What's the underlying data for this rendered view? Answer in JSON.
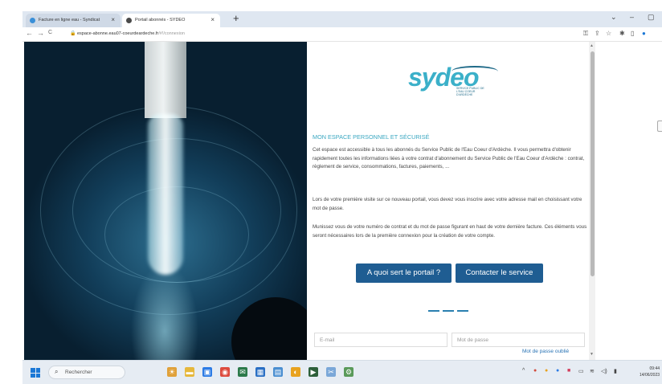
{
  "browser": {
    "tabs": [
      {
        "label": "Facture en ligne eau - Syndicat",
        "fav_color": "#3a8fd8"
      },
      {
        "label": "Portail abonnés - SYDEO",
        "fav_color": "#4a4a4a"
      }
    ],
    "new_tab_glyph": "+",
    "window_controls": [
      "⌄",
      "–",
      "▢"
    ],
    "url_host": "espace-abonne.eau07-coeurdeardeche.fr",
    "url_path": "/#!/connexion",
    "nav": {
      "back": "←",
      "forward": "→",
      "reload": "C"
    },
    "extension_icons": [
      "key-icon",
      "share-icon",
      "star-icon",
      "extension-icon",
      "sidebar-icon",
      "profile-icon"
    ]
  },
  "logo": {
    "text": "sydeo",
    "tagline": "SERVICE PUBLIC DE L'EAU COEUR D'ARDÈCHE"
  },
  "page": {
    "heading": "MON ESPACE PERSONNEL ET SÉCURISÉ",
    "paragraph1": "Cet espace est accessible à tous les abonnés du Service Public de l'Eau Coeur d'Ardèche. Il vous permettra d'obtenir rapidement toutes les informations liées à votre contrat d'abonnement du Service Public de l'Eau Coeur d'Ardèche : contrat, règlement de service, consommations, factures, paiements, ...",
    "paragraph2": "Lors de votre première visite sur ce nouveau portail, vous devez vous inscrire avec votre adresse mail en choisissant votre mot de passe.",
    "paragraph3": "Munissez vous de votre numéro de contrat et du mot de passe figurant en haut de votre dernière facture. Ces éléments vous seront nécessaires lors de la première connexion pour la création de votre compte.",
    "button_about": "A quoi sert le portail ?",
    "button_contact": "Contacter le service",
    "email_placeholder": "E-mail",
    "password_placeholder": "Mot de passe",
    "forgot_password": "Mot de passe oublié"
  },
  "taskbar": {
    "search_label": "Rechercher",
    "app_icons": [
      {
        "name": "weather-app-icon",
        "color": "#e0a13a"
      },
      {
        "name": "file-explorer-icon",
        "color": "#e6b83c"
      },
      {
        "name": "store-icon",
        "color": "#2c7be5"
      },
      {
        "name": "chrome-icon",
        "color": "#dd4b3e"
      },
      {
        "name": "mail-icon",
        "color": "#2c7a4b"
      },
      {
        "name": "calendar-icon",
        "color": "#2a6fc4"
      },
      {
        "name": "notes-icon",
        "color": "#4b8fd1"
      },
      {
        "name": "paint-icon",
        "color": "#e8a21f"
      },
      {
        "name": "media-icon",
        "color": "#2d5f3a"
      },
      {
        "name": "snipping-icon",
        "color": "#7aa7d8"
      },
      {
        "name": "settings-icon",
        "color": "#5a9a5a"
      }
    ],
    "time": "09:44",
    "date": "14/06/2023"
  }
}
